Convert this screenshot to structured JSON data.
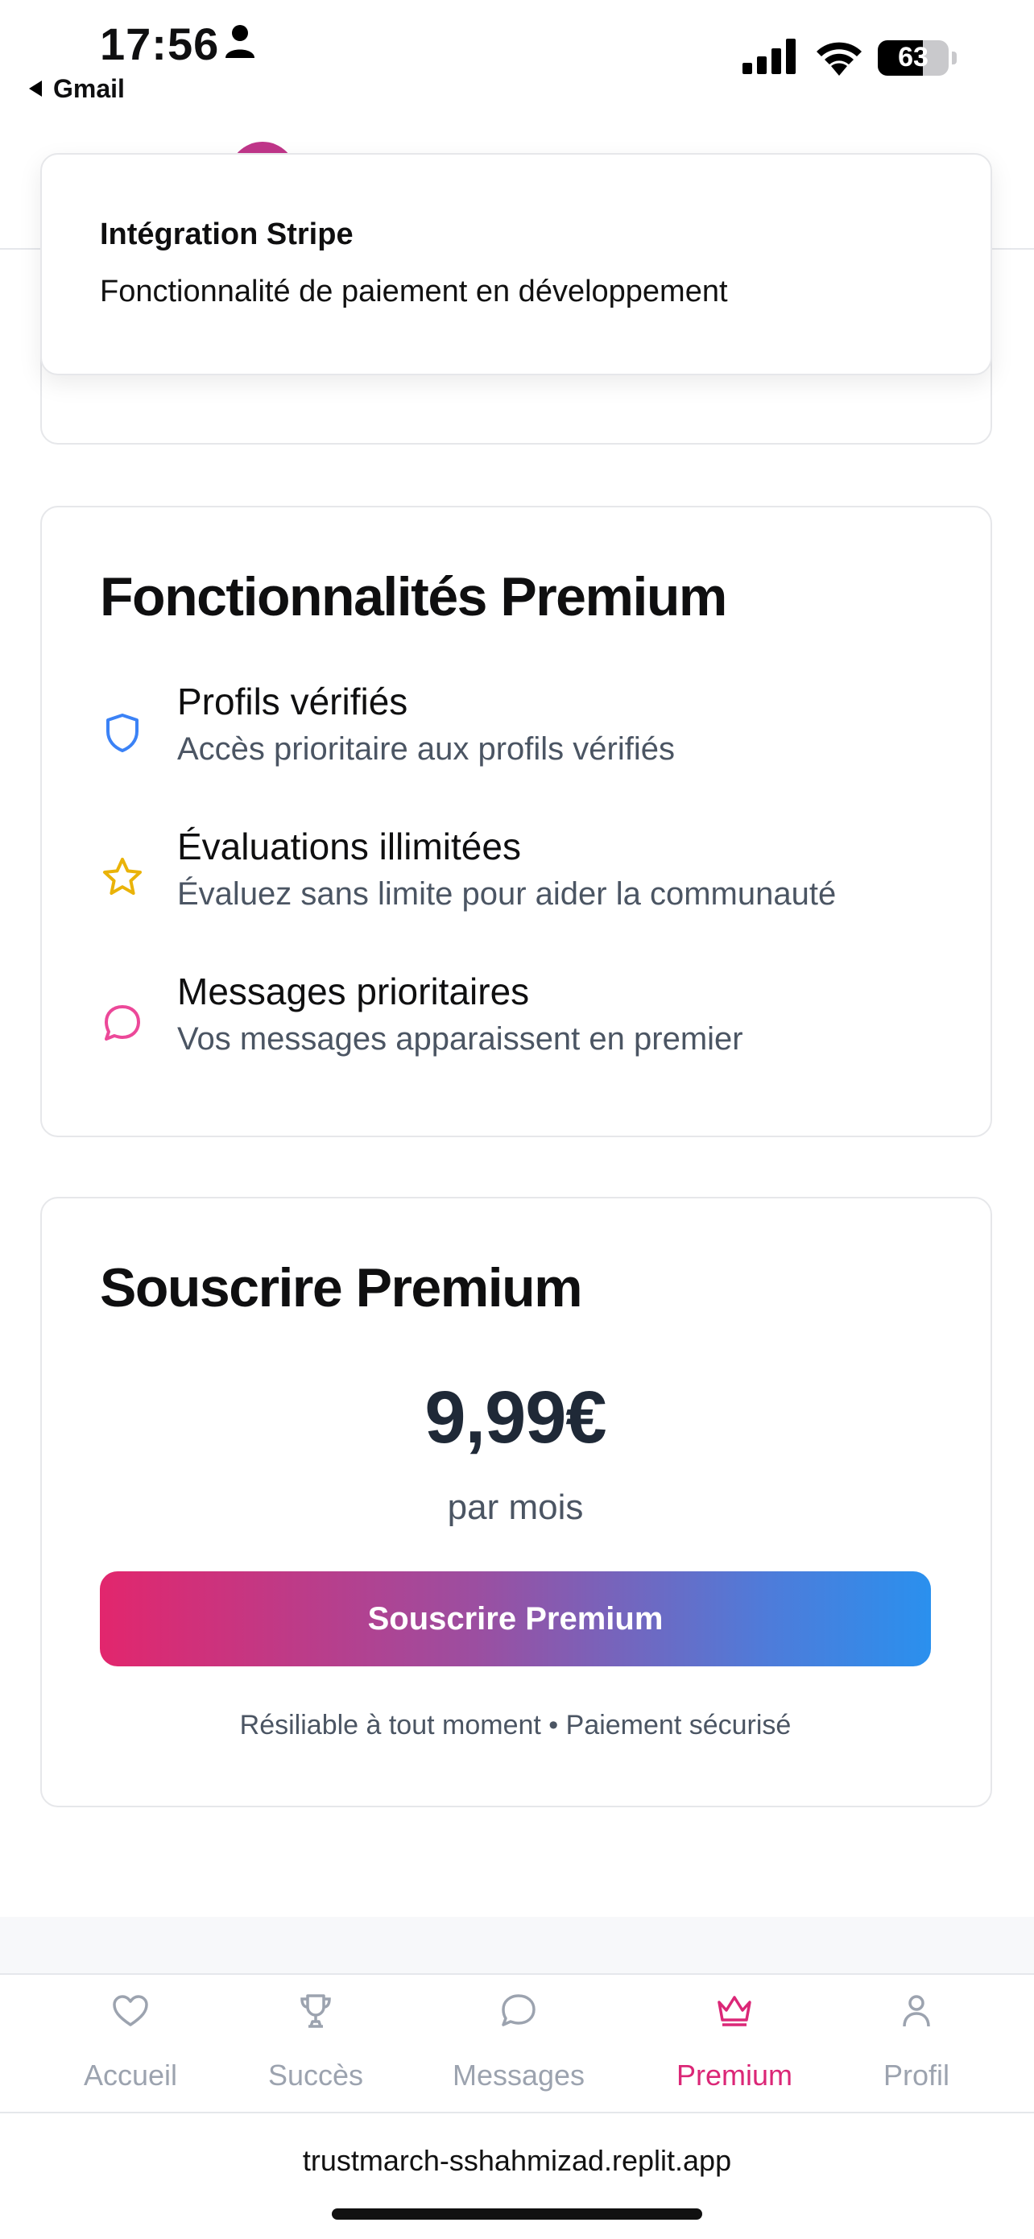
{
  "status_bar": {
    "time": "17:56",
    "back_app": "Gmail",
    "battery": "63"
  },
  "toast": {
    "title": "Intégration Stripe",
    "description": "Fonctionnalité de paiement en développement"
  },
  "features_card": {
    "title": "Fonctionnalités Premium",
    "items": [
      {
        "icon": "shield-icon",
        "title": "Profils vérifiés",
        "description": "Accès prioritaire aux profils vérifiés",
        "color": "#3b82f6"
      },
      {
        "icon": "star-icon",
        "title": "Évaluations illimitées",
        "description": "Évaluez sans limite pour aider la communauté",
        "color": "#eab308"
      },
      {
        "icon": "message-icon",
        "title": "Messages prioritaires",
        "description": "Vos messages apparaissent en premier",
        "color": "#ec4899"
      }
    ]
  },
  "subscribe_card": {
    "title": "Souscrire Premium",
    "price": "9,99€",
    "period": "par mois",
    "button_label": "Souscrire Premium",
    "fine_print": "Résiliable à tout moment • Paiement sécurisé"
  },
  "tabbar": {
    "items": [
      {
        "label": "Accueil",
        "icon": "heart-icon",
        "active": false
      },
      {
        "label": "Succès",
        "icon": "trophy-icon",
        "active": false
      },
      {
        "label": "Messages",
        "icon": "chat-icon",
        "active": false
      },
      {
        "label": "Premium",
        "icon": "crown-icon",
        "active": true
      },
      {
        "label": "Profil",
        "icon": "user-icon",
        "active": false
      }
    ]
  },
  "browser": {
    "url": "trustmarch-sshahmizad.replit.app"
  },
  "colors": {
    "accent": "#db2777",
    "inactive": "#9ca3af",
    "gradient_start": "#e2266d",
    "gradient_end": "#2a90ee"
  }
}
